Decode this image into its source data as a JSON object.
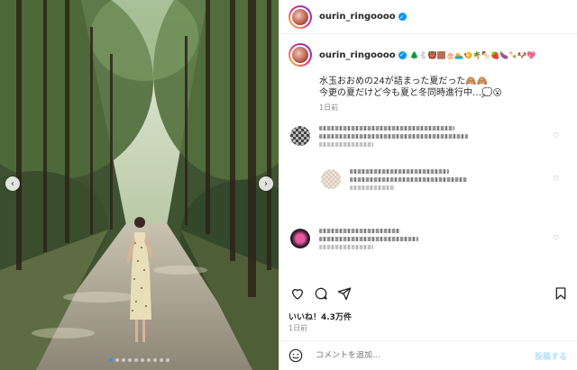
{
  "post": {
    "username": "ourin_ringoooo",
    "caption_emojis": "🌲🐇👹🟫🎂🏊🍤🌴🍢🍓🍆🍡🐶💖",
    "caption_line1": "水玉おおめの24が詰まった夏だった🙈🙈",
    "caption_line2": "今更の夏だけど今も夏と冬同時進行中…💭😮",
    "caption_time": "1日前",
    "likes": "いいね！4.3万件",
    "age": "1日前"
  },
  "comment_box": {
    "placeholder": "コメントを追加...",
    "post_label": "投稿する"
  },
  "photo": {
    "slide_count": 10,
    "active_slide": 0
  },
  "colors": {
    "verified": "#0095f6",
    "post_button": "#b2dffc",
    "muted": "#8e8e8e"
  },
  "icons": [
    "heart-icon",
    "comment-icon",
    "share-icon",
    "bookmark-icon",
    "emoji-icon",
    "verified-icon",
    "chevron-left-icon",
    "chevron-right-icon"
  ]
}
